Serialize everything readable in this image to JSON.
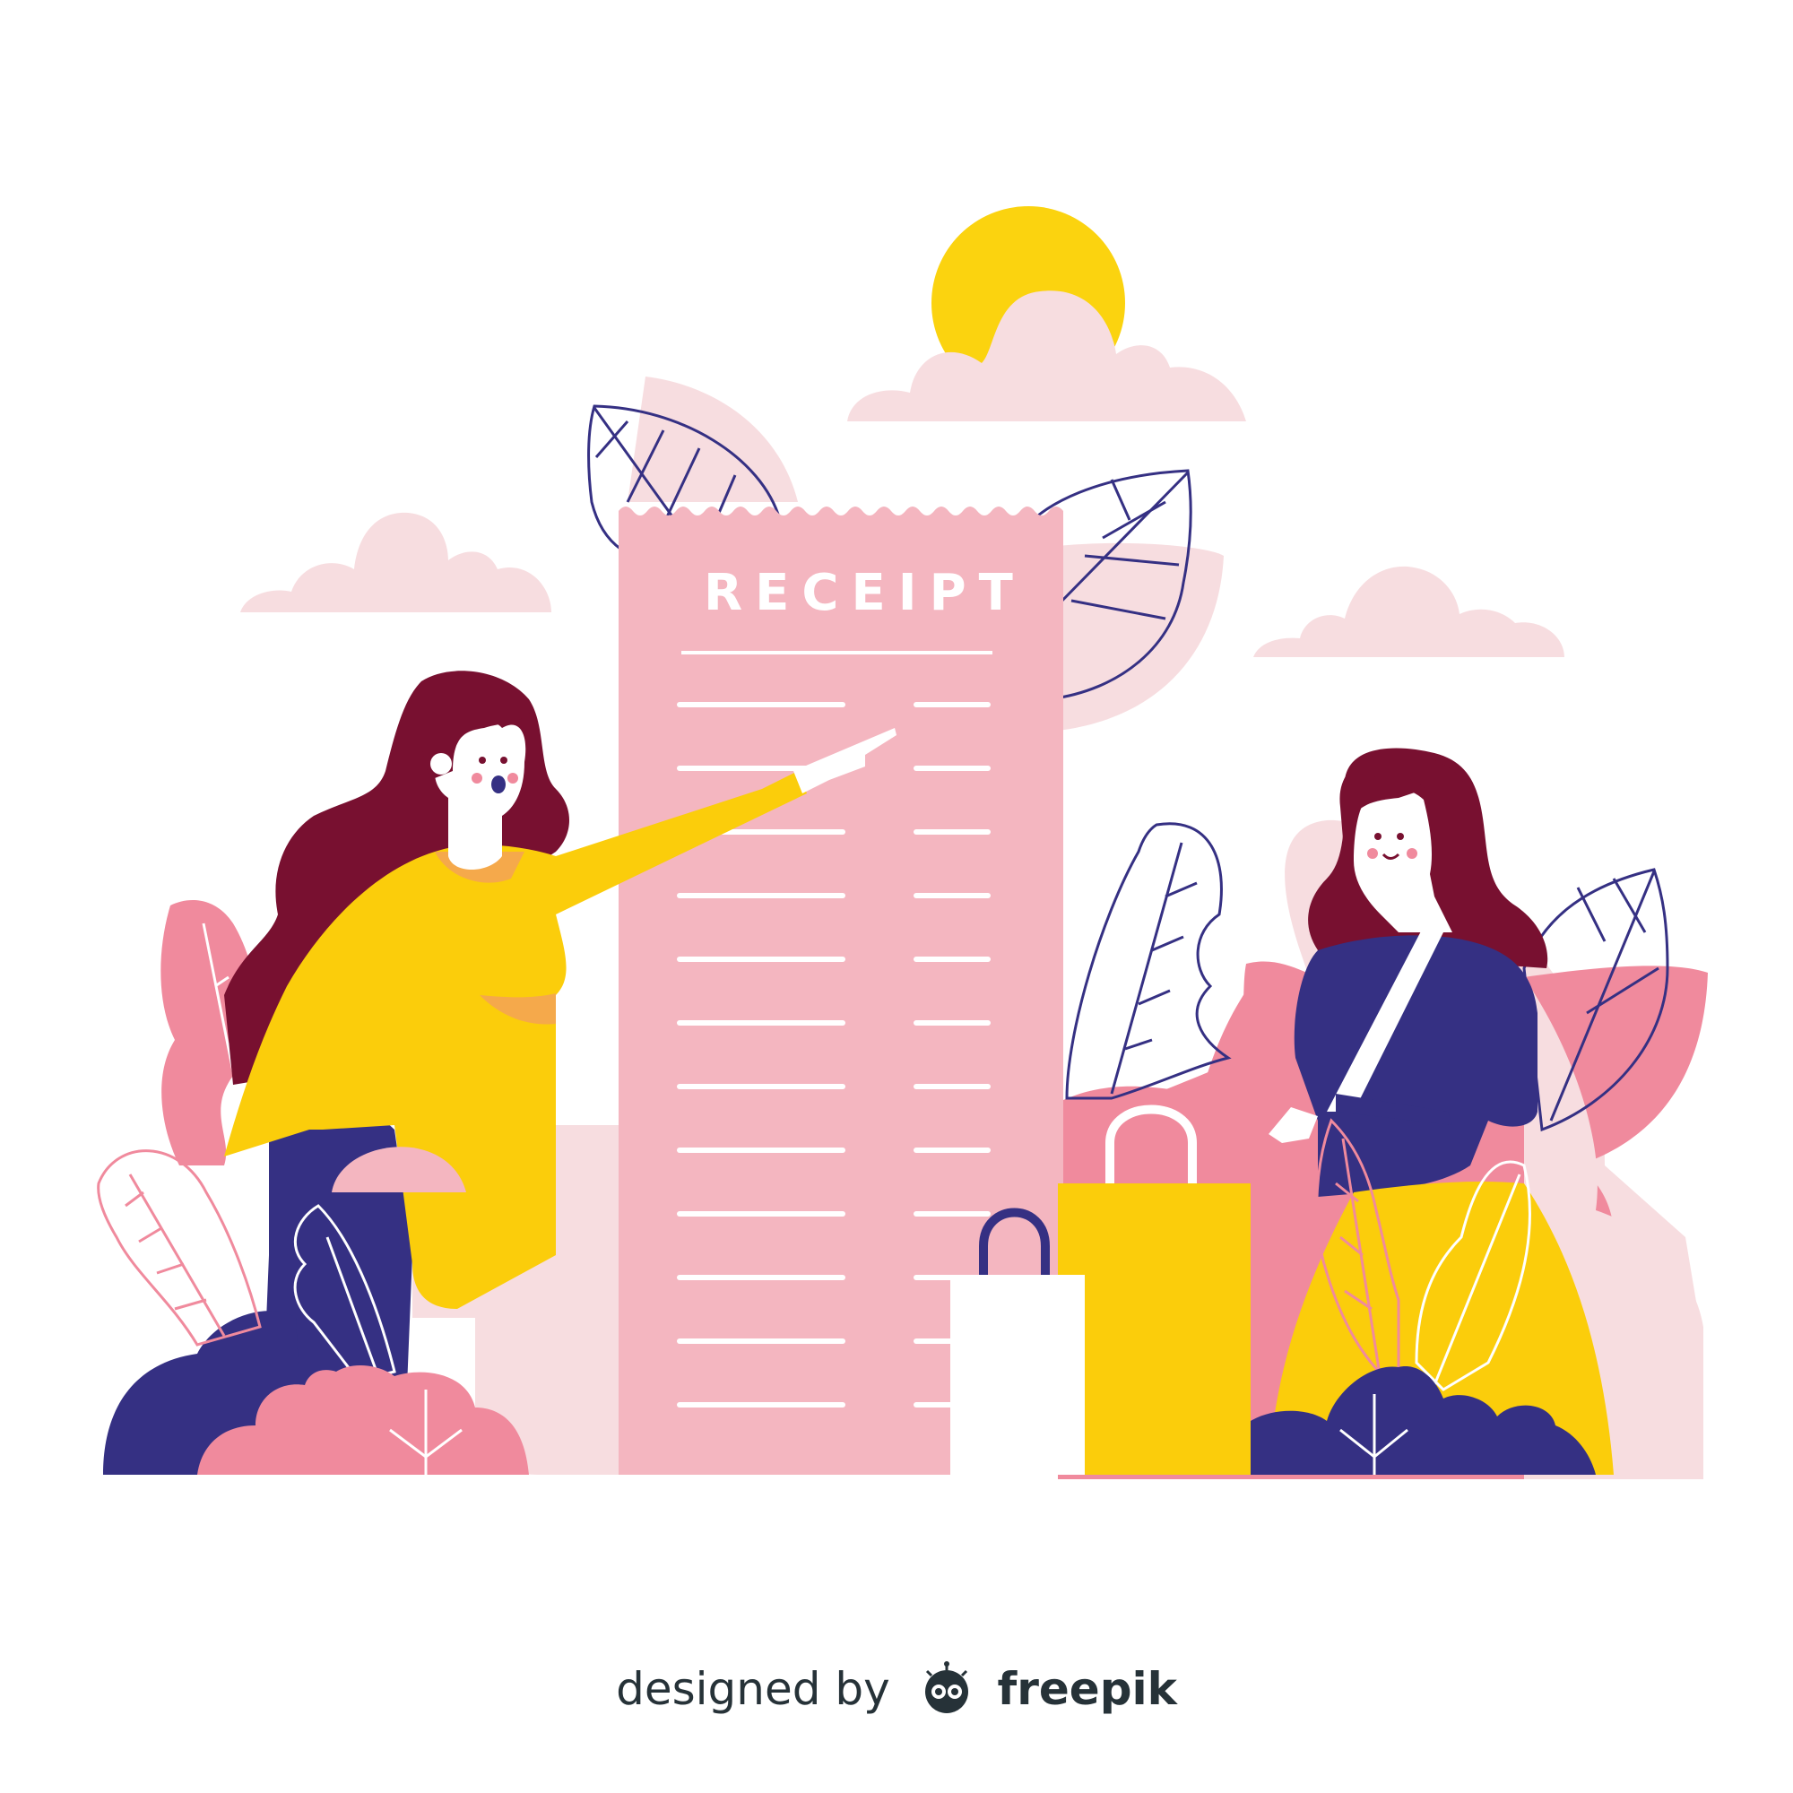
{
  "receipt": {
    "title": "RECEIPT"
  },
  "credit": {
    "designed_by": "designed by",
    "brand": "freepik"
  },
  "colors": {
    "receipt_pink": "#f4b6c0",
    "cloud_pink": "#f7dde0",
    "rose": "#f08a9d",
    "navy": "#353083",
    "yellow": "#fbcd0b",
    "hair": "#781030",
    "sun": "#fbd30f"
  }
}
